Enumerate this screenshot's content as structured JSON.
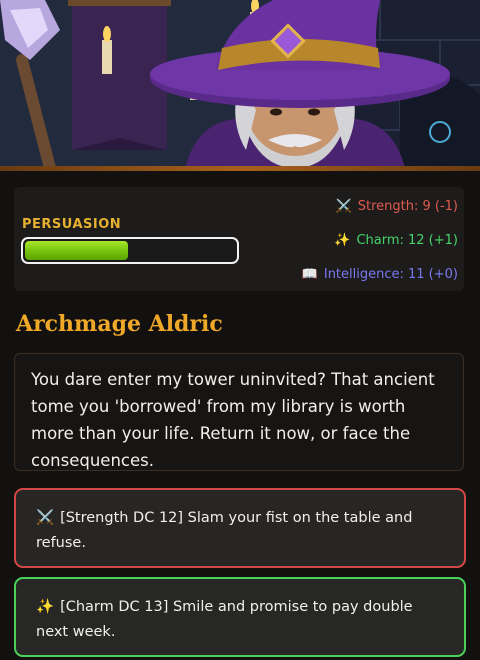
{
  "npc": {
    "name": "Archmage Aldric",
    "dialogue": "You dare enter my tower uninvited? That ancient tome you 'borrowed' from my library is worth more than your life. Return it now, or face the consequences."
  },
  "persuasion": {
    "label": "PERSUASION",
    "level": 0.5
  },
  "stats": [
    {
      "icon": "⚔️",
      "icon_name": "crossed-swords-icon",
      "text": "Strength: 9 (-1)",
      "color": "#e05a4e"
    },
    {
      "icon": "✨",
      "icon_name": "sparkles-icon",
      "text": "Charm: 12 (+1)",
      "color": "#46d46a"
    },
    {
      "icon": "📖",
      "icon_name": "book-icon",
      "text": "Intelligence: 11 (+0)",
      "color": "#7878f0"
    }
  ],
  "choices": [
    {
      "icon": "⚔️",
      "icon_name": "crossed-swords-icon",
      "text": "[Strength DC 12] Slam your fist on the table and refuse.",
      "border_color": "#d24844"
    },
    {
      "icon": "✨",
      "icon_name": "sparkles-icon",
      "text": "[Charm DC 13] Smile and promise to pay double next week.",
      "border_color": "#4cd05a"
    }
  ],
  "colors": {
    "accent": "#f0a828",
    "persuasion_bar": "#8ed81a"
  }
}
